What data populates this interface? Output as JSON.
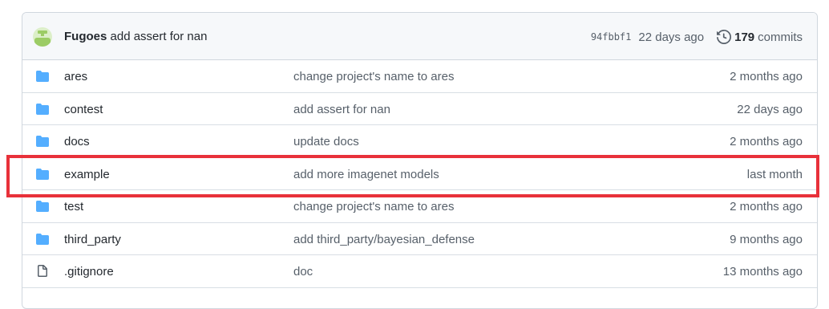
{
  "commit": {
    "author": "Fugoes",
    "message": "add assert for nan",
    "sha": "94fbbf1",
    "ago": "22 days ago",
    "commits_count": "179",
    "commits_label": "commits"
  },
  "files": [
    {
      "type": "folder",
      "name": "ares",
      "message": "change project's name to ares",
      "age": "2 months ago"
    },
    {
      "type": "folder",
      "name": "contest",
      "message": "add assert for nan",
      "age": "22 days ago"
    },
    {
      "type": "folder",
      "name": "docs",
      "message": "update docs",
      "age": "2 months ago"
    },
    {
      "type": "folder",
      "name": "example",
      "message": "add more imagenet models",
      "age": "last month"
    },
    {
      "type": "folder",
      "name": "test",
      "message": "change project's name to ares",
      "age": "2 months ago"
    },
    {
      "type": "folder",
      "name": "third_party",
      "message": "add third_party/bayesian_defense",
      "age": "9 months ago"
    },
    {
      "type": "file",
      "name": ".gitignore",
      "message": "doc",
      "age": "13 months ago"
    }
  ],
  "colors": {
    "folder": "#54aeff",
    "highlight": "#e8313a",
    "header_bg": "#f6f8fa"
  }
}
